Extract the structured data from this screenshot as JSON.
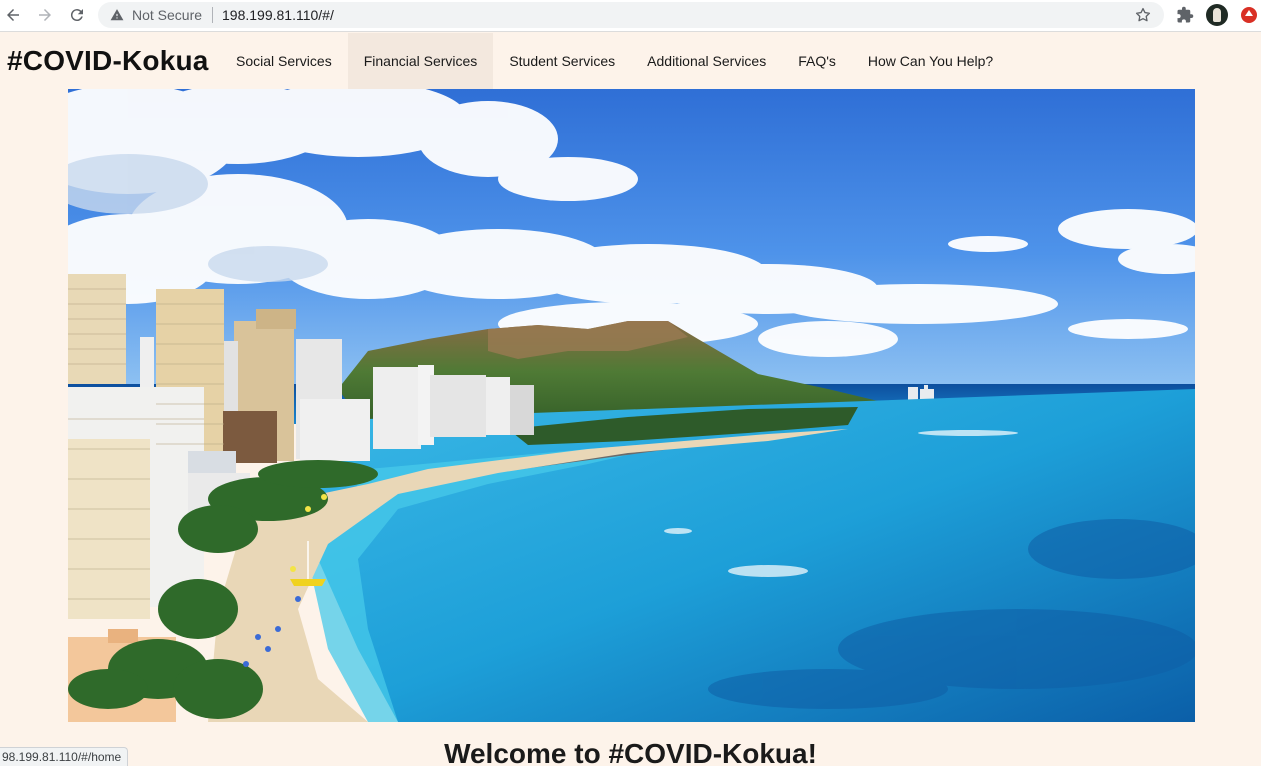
{
  "browser": {
    "security_label": "Not Secure",
    "url": "198.199.81.110/#/",
    "status_url": "98.199.81.110/#/home"
  },
  "site": {
    "brand": "#COVID-Kokua",
    "menu": [
      {
        "label": "Social Services"
      },
      {
        "label": "Financial Services"
      },
      {
        "label": "Student Services"
      },
      {
        "label": "Additional Services"
      },
      {
        "label": "FAQ's"
      },
      {
        "label": "How Can You Help?"
      }
    ],
    "active_menu": "Financial Services",
    "welcome": "Welcome to #COVID-Kokua!"
  },
  "colors": {
    "page_bg": "#fdf3ea",
    "menu_active_bg": "#f3e8de"
  }
}
